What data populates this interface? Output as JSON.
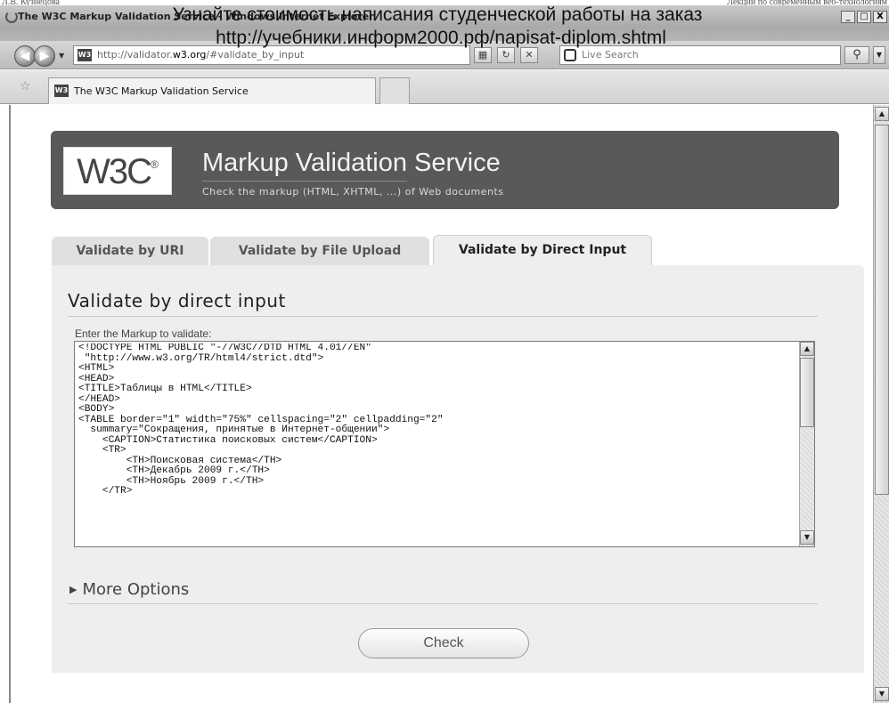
{
  "doc_header": {
    "left": "Л.В. Кузнецова",
    "right": "Лекции по современным веб-технологиям"
  },
  "window": {
    "title": "The W3C Markup Validation Service - Windows Internet Explorer",
    "buttons": [
      "_",
      "□",
      "X"
    ]
  },
  "overlay": {
    "line1": "Узнайте стоимость написания студенческой работы на заказ",
    "line2": "http://учебники.информ2000.рф/napisat-diplom.shtml"
  },
  "navbar": {
    "address_prefix": "http://validator.",
    "address_host": "w3.org",
    "address_suffix": "/#validate_by_input",
    "search_placeholder": "Live Search",
    "favicon_text": "W3"
  },
  "tab": {
    "label": "The W3C Markup Validation Service"
  },
  "banner": {
    "logo_text": "W3C",
    "logo_mark": "®",
    "title": "Markup Validation Service",
    "subtitle": "Check the markup (HTML, XHTML, ...) of Web documents"
  },
  "tabs": [
    {
      "label": "Validate by URI",
      "active": false
    },
    {
      "label": "Validate by File Upload",
      "active": false
    },
    {
      "label": "Validate by Direct Input",
      "active": true
    }
  ],
  "form": {
    "heading": "Validate by direct input",
    "field_label": "Enter the Markup to validate:",
    "code": "<!DOCTYPE HTML PUBLIC \"-//W3C//DTD HTML 4.01//EN\"\n \"http://www.w3.org/TR/html4/strict.dtd\">\n<HTML>\n<HEAD>\n<TITLE>Таблицы в HTML</TITLE>\n</HEAD>\n<BODY>\n<TABLE border=\"1\" width=\"75%\" cellspacing=\"2\" cellpadding=\"2\"\n  summary=\"Сокращения, принятые в Интернет-общении\">\n    <CAPTION>Статистика поисковых систем</CAPTION>\n    <TR>\n        <TH>Поисковая система</TH>\n        <TH>Декабрь 2009 г.</TH>\n        <TH>Ноябрь 2009 г.</TH>\n    </TR>",
    "more_options": "More Options",
    "check_label": "Check"
  }
}
